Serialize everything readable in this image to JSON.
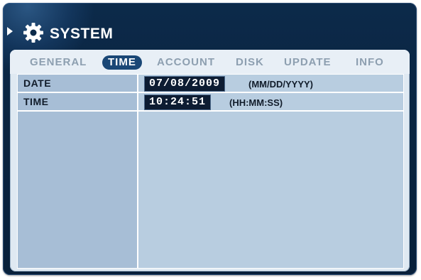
{
  "window": {
    "title": "SYSTEM",
    "title_icon": "gear-icon"
  },
  "tabs": [
    {
      "label": "GENERAL",
      "active": false
    },
    {
      "label": "TIME",
      "active": true
    },
    {
      "label": "ACCOUNT",
      "active": false
    },
    {
      "label": "DISK",
      "active": false
    },
    {
      "label": "UPDATE",
      "active": false
    },
    {
      "label": "INFO",
      "active": false
    }
  ],
  "fields": {
    "date": {
      "label": "DATE",
      "value": "07/08/2009",
      "format": "(MM/DD/YYYY)"
    },
    "time": {
      "label": "TIME",
      "value": "10:24:51",
      "format": "(HH:MM:SS)"
    }
  },
  "colors": {
    "frame": "#0a2440",
    "panel": "#dfe9f2",
    "tab_active_bg": "#1a4776",
    "value_box_bg": "#0d1c32"
  }
}
